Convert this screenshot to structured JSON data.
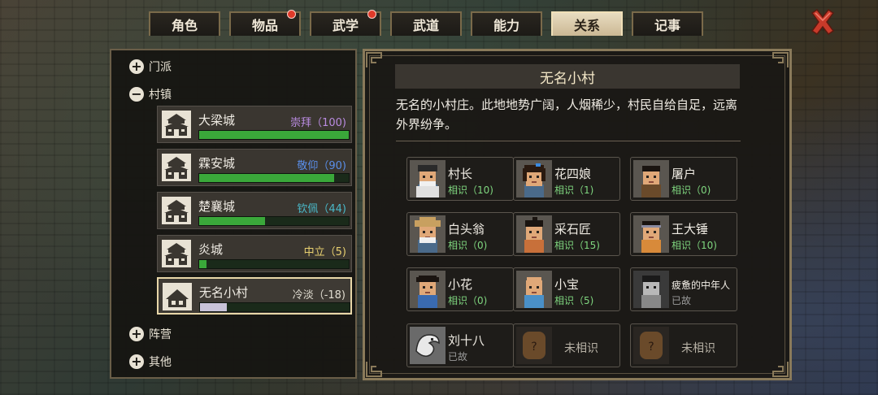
{
  "tabs": [
    {
      "label": "角色",
      "alert": false
    },
    {
      "label": "物品",
      "alert": true
    },
    {
      "label": "武学",
      "alert": true
    },
    {
      "label": "武道",
      "alert": false
    },
    {
      "label": "能力",
      "alert": false
    },
    {
      "label": "关系",
      "alert": false,
      "active": true
    },
    {
      "label": "记事",
      "alert": false
    }
  ],
  "close_icon": "close-x-icon",
  "categories": {
    "sect": "门派",
    "town": "村镇",
    "camp": "阵营",
    "other": "其他"
  },
  "towns": [
    {
      "name": "大梁城",
      "rep": "崇拜（100)",
      "color": "#b98be0",
      "fill": 1.0
    },
    {
      "name": "霖安城",
      "rep": "敬仰（90)",
      "color": "#5a8ee8",
      "fill": 0.9
    },
    {
      "name": "楚襄城",
      "rep": "钦佩（44)",
      "color": "#4ab8c8",
      "fill": 0.44
    },
    {
      "name": "炎城",
      "rep": "中立（5)",
      "color": "#e8d070",
      "fill": 0.05
    },
    {
      "name": "无名小村",
      "rep": "冷淡（-18)",
      "color": "#e0dcd0",
      "fill": 0.18,
      "selected": true
    }
  ],
  "detail": {
    "title": "无名小村",
    "description": "无名的小村庄。此地地势广阔，人烟稀少，村民自给自足，远离外界纷争。"
  },
  "npcs": [
    {
      "name": "村长",
      "status": "相识（10)",
      "kind": "elder"
    },
    {
      "name": "花四娘",
      "status": "相识（1)",
      "kind": "woman"
    },
    {
      "name": "屠户",
      "status": "相识（0)",
      "kind": "man"
    },
    {
      "name": "白头翁",
      "status": "相识（0)",
      "kind": "hat"
    },
    {
      "name": "采石匠",
      "status": "相识（15)",
      "kind": "man2"
    },
    {
      "name": "王大锤",
      "status": "相识（10)",
      "kind": "band"
    },
    {
      "name": "小花",
      "status": "相识（0)",
      "kind": "kid"
    },
    {
      "name": "小宝",
      "status": "相识（5)",
      "kind": "bald"
    },
    {
      "name": "疲惫的中年人",
      "status": "已故",
      "kind": "dead"
    },
    {
      "name": "刘十八",
      "status": "已故",
      "kind": "dragon"
    },
    {
      "name": "",
      "status": "未相识",
      "kind": "unknown"
    },
    {
      "name": "",
      "status": "未相识",
      "kind": "unknown"
    }
  ]
}
